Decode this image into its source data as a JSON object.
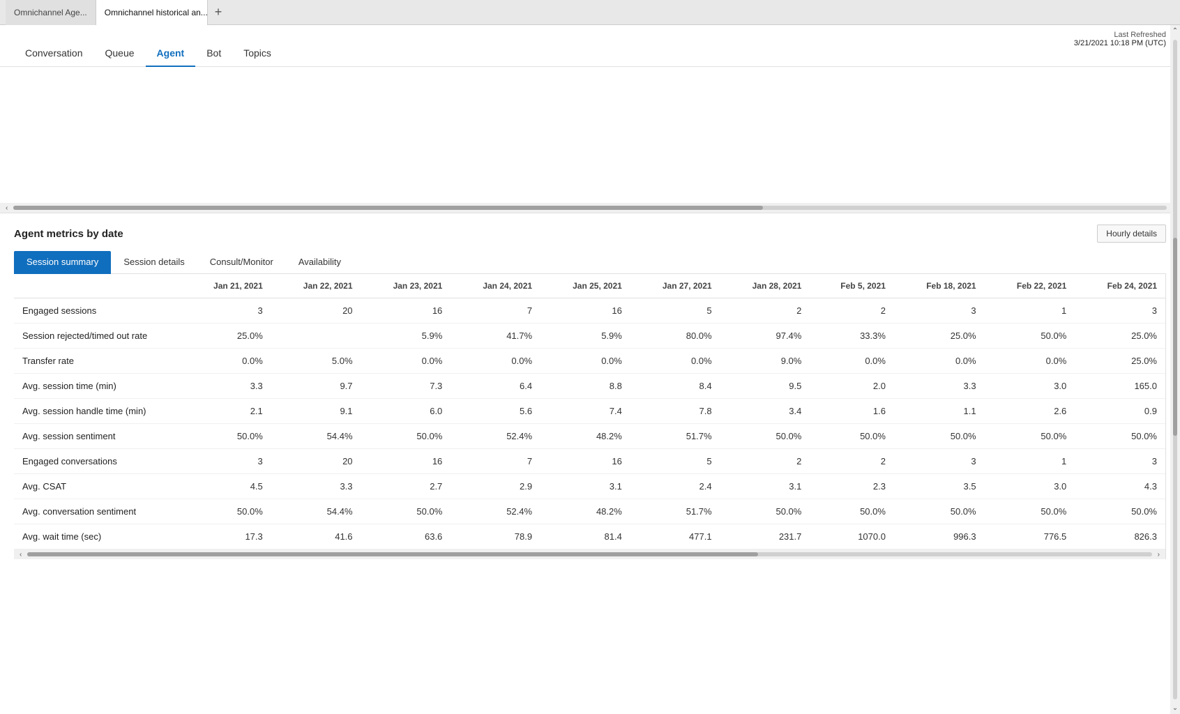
{
  "browser": {
    "tabs": [
      {
        "label": "Omnichannel Age...",
        "active": false
      },
      {
        "label": "Omnichannel historical an...",
        "active": true
      }
    ],
    "new_tab_icon": "+"
  },
  "nav": {
    "items": [
      {
        "key": "conversation",
        "label": "Conversation",
        "active": false
      },
      {
        "key": "queue",
        "label": "Queue",
        "active": false
      },
      {
        "key": "agent",
        "label": "Agent",
        "active": true
      },
      {
        "key": "bot",
        "label": "Bot",
        "active": false
      },
      {
        "key": "topics",
        "label": "Topics",
        "active": false
      }
    ],
    "last_refreshed_label": "Last Refreshed",
    "last_refreshed_value": "3/21/2021 10:18 PM (UTC)"
  },
  "metrics": {
    "title": "Agent metrics by date",
    "hourly_details_label": "Hourly details",
    "subtabs": [
      {
        "key": "session-summary",
        "label": "Session summary",
        "active": true
      },
      {
        "key": "session-details",
        "label": "Session details",
        "active": false
      },
      {
        "key": "consult-monitor",
        "label": "Consult/Monitor",
        "active": false
      },
      {
        "key": "availability",
        "label": "Availability",
        "active": false
      }
    ],
    "table": {
      "columns": [
        "",
        "Jan 21, 2021",
        "Jan 22, 2021",
        "Jan 23, 2021",
        "Jan 24, 2021",
        "Jan 25, 2021",
        "Jan 27, 2021",
        "Jan 28, 2021",
        "Feb 5, 2021",
        "Feb 18, 2021",
        "Feb 22, 2021",
        "Feb 24, 2021"
      ],
      "rows": [
        {
          "label": "Engaged sessions",
          "values": [
            "3",
            "20",
            "16",
            "7",
            "16",
            "5",
            "2",
            "2",
            "3",
            "1",
            "3"
          ]
        },
        {
          "label": "Session rejected/timed out rate",
          "values": [
            "25.0%",
            "",
            "5.9%",
            "41.7%",
            "5.9%",
            "80.0%",
            "97.4%",
            "33.3%",
            "25.0%",
            "50.0%",
            "25.0%"
          ]
        },
        {
          "label": "Transfer rate",
          "values": [
            "0.0%",
            "5.0%",
            "0.0%",
            "0.0%",
            "0.0%",
            "0.0%",
            "9.0%",
            "0.0%",
            "0.0%",
            "0.0%",
            "25.0%"
          ]
        },
        {
          "label": "Avg. session time (min)",
          "values": [
            "3.3",
            "9.7",
            "7.3",
            "6.4",
            "8.8",
            "8.4",
            "9.5",
            "2.0",
            "3.3",
            "3.0",
            "165.0"
          ]
        },
        {
          "label": "Avg. session handle time (min)",
          "values": [
            "2.1",
            "9.1",
            "6.0",
            "5.6",
            "7.4",
            "7.8",
            "3.4",
            "1.6",
            "1.1",
            "2.6",
            "0.9"
          ]
        },
        {
          "label": "Avg. session sentiment",
          "values": [
            "50.0%",
            "54.4%",
            "50.0%",
            "52.4%",
            "48.2%",
            "51.7%",
            "50.0%",
            "50.0%",
            "50.0%",
            "50.0%",
            "50.0%"
          ]
        },
        {
          "label": "Engaged conversations",
          "values": [
            "3",
            "20",
            "16",
            "7",
            "16",
            "5",
            "2",
            "2",
            "3",
            "1",
            "3"
          ]
        },
        {
          "label": "Avg. CSAT",
          "values": [
            "4.5",
            "3.3",
            "2.7",
            "2.9",
            "3.1",
            "2.4",
            "3.1",
            "2.3",
            "3.5",
            "3.0",
            "4.3"
          ]
        },
        {
          "label": "Avg. conversation sentiment",
          "values": [
            "50.0%",
            "54.4%",
            "50.0%",
            "52.4%",
            "48.2%",
            "51.7%",
            "50.0%",
            "50.0%",
            "50.0%",
            "50.0%",
            "50.0%"
          ]
        },
        {
          "label": "Avg. wait time (sec)",
          "values": [
            "17.3",
            "41.6",
            "63.6",
            "78.9",
            "81.4",
            "477.1",
            "231.7",
            "1070.0",
            "996.3",
            "776.5",
            "826.3"
          ]
        }
      ]
    }
  }
}
